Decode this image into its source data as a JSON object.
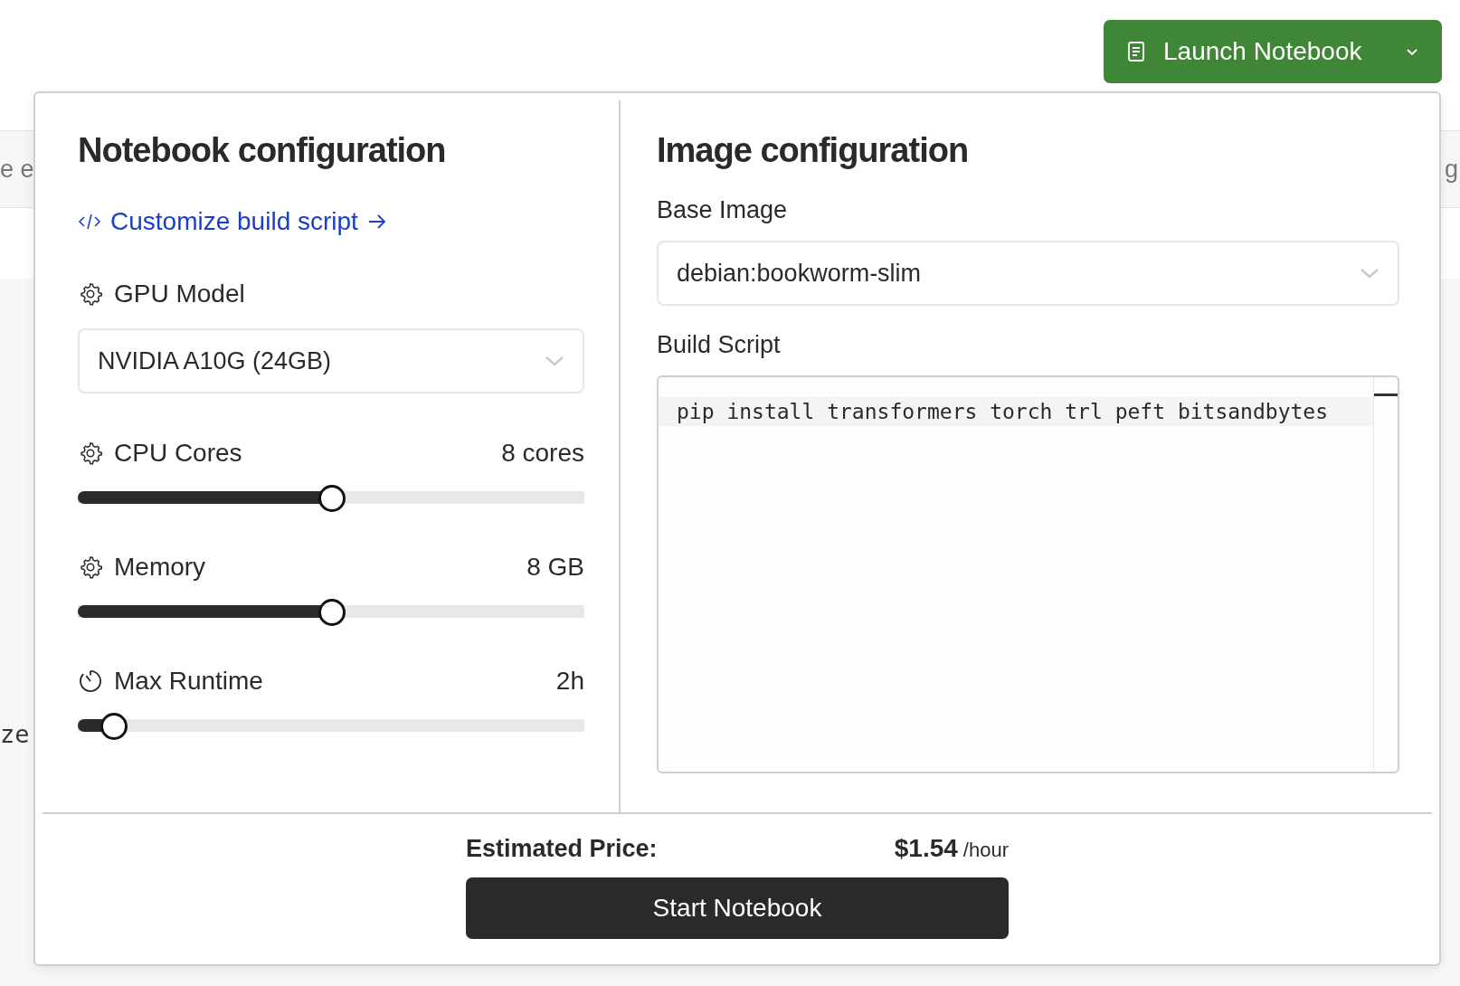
{
  "background_fragments": [
    {
      "text": "e e",
      "kind": "sans"
    },
    {
      "text": "g",
      "kind": "sans"
    },
    {
      "text": "ze",
      "kind": "mono"
    }
  ],
  "launch_button": {
    "label": "Launch Notebook"
  },
  "notebook_config": {
    "title": "Notebook configuration",
    "customize_link": "Customize build script",
    "gpu": {
      "label": "GPU Model",
      "value": "NVIDIA A10G (24GB)"
    },
    "sliders": [
      {
        "label": "CPU Cores",
        "reading": "8 cores",
        "level": 0.5
      },
      {
        "label": "Memory",
        "reading": "8 GB",
        "level": 0.5
      },
      {
        "label": "Max Runtime",
        "reading": "2h",
        "level": 0.07
      }
    ]
  },
  "image_config": {
    "title": "Image configuration",
    "base_image": {
      "label": "Base Image",
      "value": "debian:bookworm-slim"
    },
    "build_script": {
      "label": "Build Script",
      "lines": [
        "pip install transformers torch trl peft bitsandbytes"
      ]
    }
  },
  "footer": {
    "price_label": "Estimated Price:",
    "price": "$1.54",
    "unit": "/hour",
    "start_button": "Start Notebook"
  }
}
